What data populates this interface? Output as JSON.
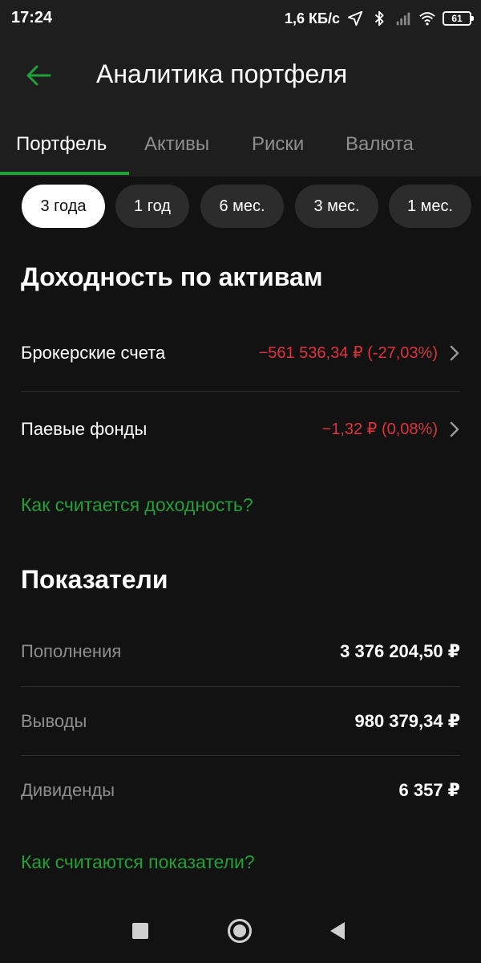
{
  "status_bar": {
    "time": "17:24",
    "net_speed": "1,6 КБ/с",
    "battery": "61"
  },
  "header": {
    "title": "Аналитика портфеля",
    "back_icon": "arrow-left-icon",
    "accent_color": "#21a038"
  },
  "tabs": [
    {
      "label": "Портфель",
      "active": true
    },
    {
      "label": "Активы",
      "active": false
    },
    {
      "label": "Риски",
      "active": false
    },
    {
      "label": "Валюта",
      "active": false
    }
  ],
  "periods": [
    {
      "label": "3 года",
      "active": true
    },
    {
      "label": "1 год",
      "active": false
    },
    {
      "label": "6 мес.",
      "active": false
    },
    {
      "label": "3 мес.",
      "active": false
    },
    {
      "label": "1 мес.",
      "active": false
    }
  ],
  "returns": {
    "title": "Доходность по активам",
    "negative_color": "#e0323e",
    "items": [
      {
        "label": "Брокерские счета",
        "value": "−561 536,34 ₽ (-27,03%)"
      },
      {
        "label": "Паевые фонды",
        "value": "−1,32 ₽ (0,08%)"
      }
    ],
    "help_link": "Как считается доходность?"
  },
  "metrics": {
    "title": "Показатели",
    "items": [
      {
        "label": "Пополнения",
        "value": "3 376 204,50 ₽"
      },
      {
        "label": "Выводы",
        "value": "980 379,34 ₽"
      },
      {
        "label": "Дивиденды",
        "value": "6 357 ₽"
      }
    ],
    "help_link": "Как считаются показатели?"
  }
}
